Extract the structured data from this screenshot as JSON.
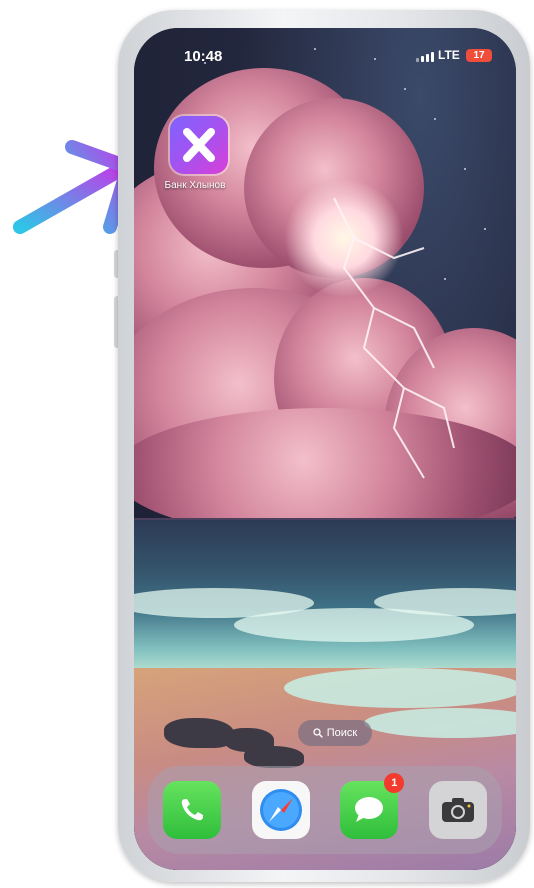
{
  "status_bar": {
    "time": "10:48",
    "network": "LTE",
    "battery": "17"
  },
  "home": {
    "apps": [
      {
        "label": "Банк Хлынов",
        "icon": "x-icon"
      }
    ]
  },
  "search": {
    "label": "Поиск",
    "icon": "search-icon"
  },
  "dock": {
    "apps": [
      {
        "name": "phone",
        "icon": "phone-icon"
      },
      {
        "name": "safari",
        "icon": "compass-icon"
      },
      {
        "name": "messages",
        "icon": "chat-bubble-icon",
        "badge": "1"
      },
      {
        "name": "camera",
        "icon": "camera-icon"
      }
    ]
  },
  "colors": {
    "arrow_start": "#2ec5e6",
    "arrow_end": "#c23ae8",
    "app_gradient_start": "#7e63ff",
    "app_gradient_end": "#d93fd8",
    "badge": "#f23a2e",
    "battery": "#f04d3a"
  }
}
